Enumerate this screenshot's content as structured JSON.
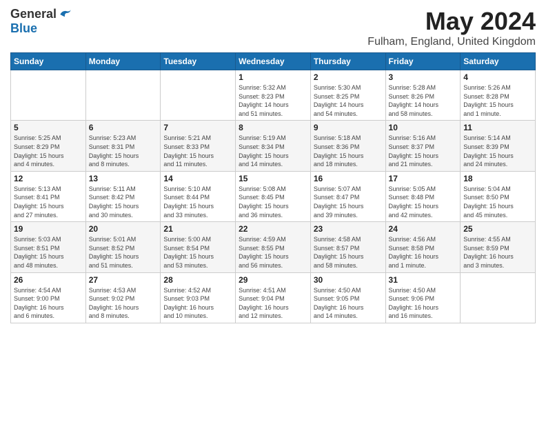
{
  "header": {
    "logo": {
      "general": "General",
      "blue": "Blue"
    },
    "title": "May 2024",
    "location": "Fulham, England, United Kingdom"
  },
  "days_of_week": [
    "Sunday",
    "Monday",
    "Tuesday",
    "Wednesday",
    "Thursday",
    "Friday",
    "Saturday"
  ],
  "weeks": [
    [
      {
        "day": "",
        "info": ""
      },
      {
        "day": "",
        "info": ""
      },
      {
        "day": "",
        "info": ""
      },
      {
        "day": "1",
        "info": "Sunrise: 5:32 AM\nSunset: 8:23 PM\nDaylight: 14 hours\nand 51 minutes."
      },
      {
        "day": "2",
        "info": "Sunrise: 5:30 AM\nSunset: 8:25 PM\nDaylight: 14 hours\nand 54 minutes."
      },
      {
        "day": "3",
        "info": "Sunrise: 5:28 AM\nSunset: 8:26 PM\nDaylight: 14 hours\nand 58 minutes."
      },
      {
        "day": "4",
        "info": "Sunrise: 5:26 AM\nSunset: 8:28 PM\nDaylight: 15 hours\nand 1 minute."
      }
    ],
    [
      {
        "day": "5",
        "info": "Sunrise: 5:25 AM\nSunset: 8:29 PM\nDaylight: 15 hours\nand 4 minutes."
      },
      {
        "day": "6",
        "info": "Sunrise: 5:23 AM\nSunset: 8:31 PM\nDaylight: 15 hours\nand 8 minutes."
      },
      {
        "day": "7",
        "info": "Sunrise: 5:21 AM\nSunset: 8:33 PM\nDaylight: 15 hours\nand 11 minutes."
      },
      {
        "day": "8",
        "info": "Sunrise: 5:19 AM\nSunset: 8:34 PM\nDaylight: 15 hours\nand 14 minutes."
      },
      {
        "day": "9",
        "info": "Sunrise: 5:18 AM\nSunset: 8:36 PM\nDaylight: 15 hours\nand 18 minutes."
      },
      {
        "day": "10",
        "info": "Sunrise: 5:16 AM\nSunset: 8:37 PM\nDaylight: 15 hours\nand 21 minutes."
      },
      {
        "day": "11",
        "info": "Sunrise: 5:14 AM\nSunset: 8:39 PM\nDaylight: 15 hours\nand 24 minutes."
      }
    ],
    [
      {
        "day": "12",
        "info": "Sunrise: 5:13 AM\nSunset: 8:41 PM\nDaylight: 15 hours\nand 27 minutes."
      },
      {
        "day": "13",
        "info": "Sunrise: 5:11 AM\nSunset: 8:42 PM\nDaylight: 15 hours\nand 30 minutes."
      },
      {
        "day": "14",
        "info": "Sunrise: 5:10 AM\nSunset: 8:44 PM\nDaylight: 15 hours\nand 33 minutes."
      },
      {
        "day": "15",
        "info": "Sunrise: 5:08 AM\nSunset: 8:45 PM\nDaylight: 15 hours\nand 36 minutes."
      },
      {
        "day": "16",
        "info": "Sunrise: 5:07 AM\nSunset: 8:47 PM\nDaylight: 15 hours\nand 39 minutes."
      },
      {
        "day": "17",
        "info": "Sunrise: 5:05 AM\nSunset: 8:48 PM\nDaylight: 15 hours\nand 42 minutes."
      },
      {
        "day": "18",
        "info": "Sunrise: 5:04 AM\nSunset: 8:50 PM\nDaylight: 15 hours\nand 45 minutes."
      }
    ],
    [
      {
        "day": "19",
        "info": "Sunrise: 5:03 AM\nSunset: 8:51 PM\nDaylight: 15 hours\nand 48 minutes."
      },
      {
        "day": "20",
        "info": "Sunrise: 5:01 AM\nSunset: 8:52 PM\nDaylight: 15 hours\nand 51 minutes."
      },
      {
        "day": "21",
        "info": "Sunrise: 5:00 AM\nSunset: 8:54 PM\nDaylight: 15 hours\nand 53 minutes."
      },
      {
        "day": "22",
        "info": "Sunrise: 4:59 AM\nSunset: 8:55 PM\nDaylight: 15 hours\nand 56 minutes."
      },
      {
        "day": "23",
        "info": "Sunrise: 4:58 AM\nSunset: 8:57 PM\nDaylight: 15 hours\nand 58 minutes."
      },
      {
        "day": "24",
        "info": "Sunrise: 4:56 AM\nSunset: 8:58 PM\nDaylight: 16 hours\nand 1 minute."
      },
      {
        "day": "25",
        "info": "Sunrise: 4:55 AM\nSunset: 8:59 PM\nDaylight: 16 hours\nand 3 minutes."
      }
    ],
    [
      {
        "day": "26",
        "info": "Sunrise: 4:54 AM\nSunset: 9:00 PM\nDaylight: 16 hours\nand 6 minutes."
      },
      {
        "day": "27",
        "info": "Sunrise: 4:53 AM\nSunset: 9:02 PM\nDaylight: 16 hours\nand 8 minutes."
      },
      {
        "day": "28",
        "info": "Sunrise: 4:52 AM\nSunset: 9:03 PM\nDaylight: 16 hours\nand 10 minutes."
      },
      {
        "day": "29",
        "info": "Sunrise: 4:51 AM\nSunset: 9:04 PM\nDaylight: 16 hours\nand 12 minutes."
      },
      {
        "day": "30",
        "info": "Sunrise: 4:50 AM\nSunset: 9:05 PM\nDaylight: 16 hours\nand 14 minutes."
      },
      {
        "day": "31",
        "info": "Sunrise: 4:50 AM\nSunset: 9:06 PM\nDaylight: 16 hours\nand 16 minutes."
      },
      {
        "day": "",
        "info": ""
      }
    ]
  ]
}
